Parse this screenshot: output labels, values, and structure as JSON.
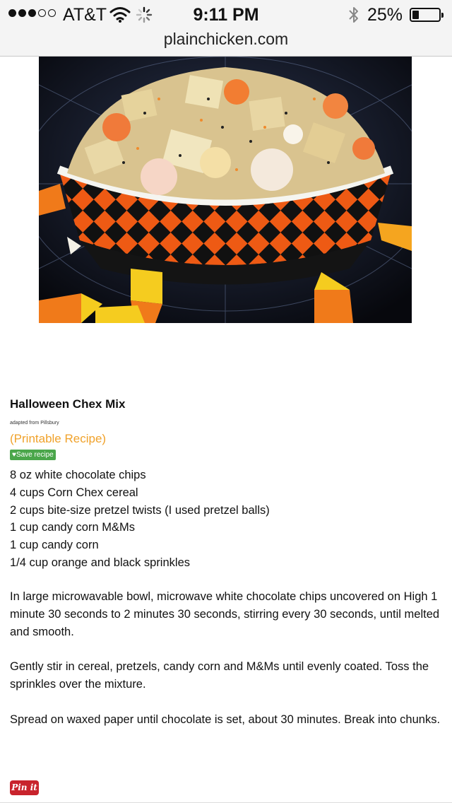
{
  "status_bar": {
    "carrier": "AT&T",
    "signal_bars_filled": 3,
    "signal_bars_total": 5,
    "time": "9:11 PM",
    "battery_percent": "25%",
    "battery_level": 0.25
  },
  "browser": {
    "url": "plainchicken.com"
  },
  "recipe": {
    "title": "Halloween Chex Mix",
    "adapted": "adapted from Pillsbury",
    "printable_link": "(Printable Recipe)",
    "save_button": "♥Save recipe",
    "ingredients": [
      "8 oz white chocolate chips",
      "4 cups Corn Chex cereal",
      "2 cups bite-size pretzel twists (I used pretzel balls)",
      "1 cup candy corn M&Ms",
      "1 cup candy corn",
      "1/4 cup orange and black sprinkles"
    ],
    "steps": [
      "In large microwavable bowl, microwave white chocolate chips uncovered on High 1 minute 30 seconds to 2 minutes 30 seconds, stirring every 30 seconds, until melted and smooth.",
      "Gently stir in cereal, pretzels, candy corn and M&Ms until evenly coated. Toss the sprinkles over the mixture.",
      "Spread on waxed paper until chocolate is set, about 30 minutes. Break into chunks."
    ],
    "pin_button": "Pin it"
  },
  "colors": {
    "link_orange": "#f0a22b",
    "save_green": "#4aa64a",
    "pinterest_red": "#c8232c"
  }
}
